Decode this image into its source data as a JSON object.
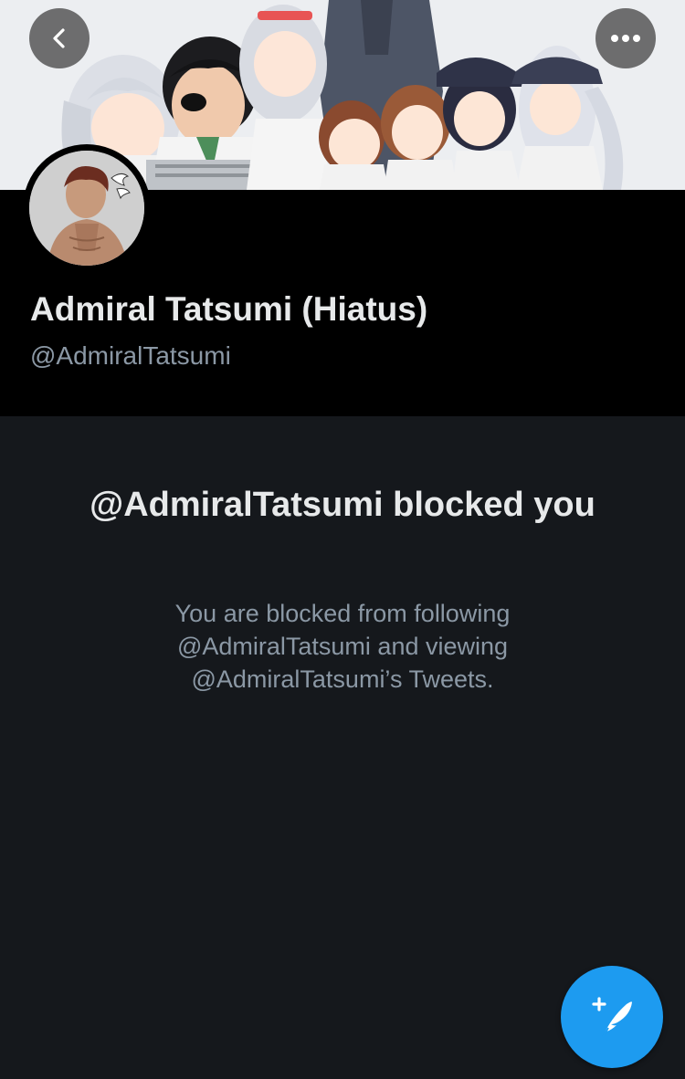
{
  "banner": {
    "image": "anime-characters-header-image"
  },
  "nav": {
    "back_icon": "chevron-left-icon",
    "more_icon": "more-horizontal-icon"
  },
  "profile": {
    "display_name": "Admiral Tatsumi (Hiatus)",
    "handle": "@AdmiralTatsumi",
    "avatar": "avatar-image"
  },
  "blocked": {
    "title": "@AdmiralTatsumi blocked you",
    "description": "You are blocked from following @AdmiralTatsumi and viewing @AdmiralTatsumi’s Tweets."
  },
  "compose": {
    "icon": "compose-tweet-icon"
  },
  "colors": {
    "background": "#15181c",
    "header_background": "#000000",
    "primary_text": "#e7e9ea",
    "secondary_text": "#8b98a5",
    "accent": "#1d9bf0"
  }
}
